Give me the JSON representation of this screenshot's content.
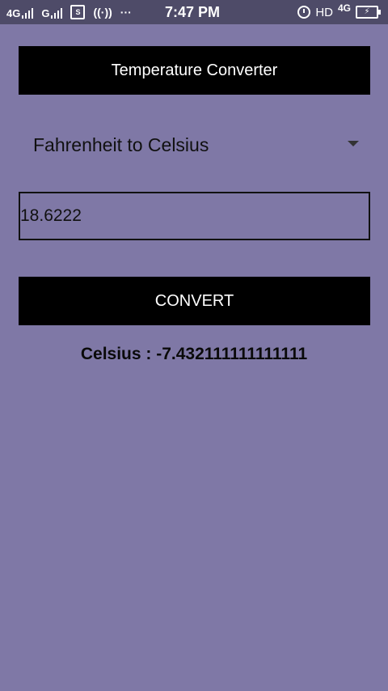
{
  "status_bar": {
    "net1": "4G",
    "net2": "G",
    "sim_icon": "S",
    "dots": "···",
    "time": "7:47 PM",
    "hd": "HD",
    "net3": "4G",
    "battery": "⚡",
    "icons": [
      "signal-icon",
      "signal-icon",
      "screenshot-icon",
      "hotspot-icon",
      "more-dots-icon",
      "alarm-icon",
      "battery-icon"
    ]
  },
  "app": {
    "title": "Temperature Converter",
    "dropdown": {
      "selected": "Fahrenheit to Celsius"
    },
    "input": {
      "value": "18.6222"
    },
    "convert_label": "CONVERT",
    "result": "Celsius : -7.432111111111111"
  },
  "colors": {
    "background": "#7f78a6",
    "status_bar": "#4e4b68",
    "bar": "#000000",
    "bar_text": "#ffffff"
  }
}
